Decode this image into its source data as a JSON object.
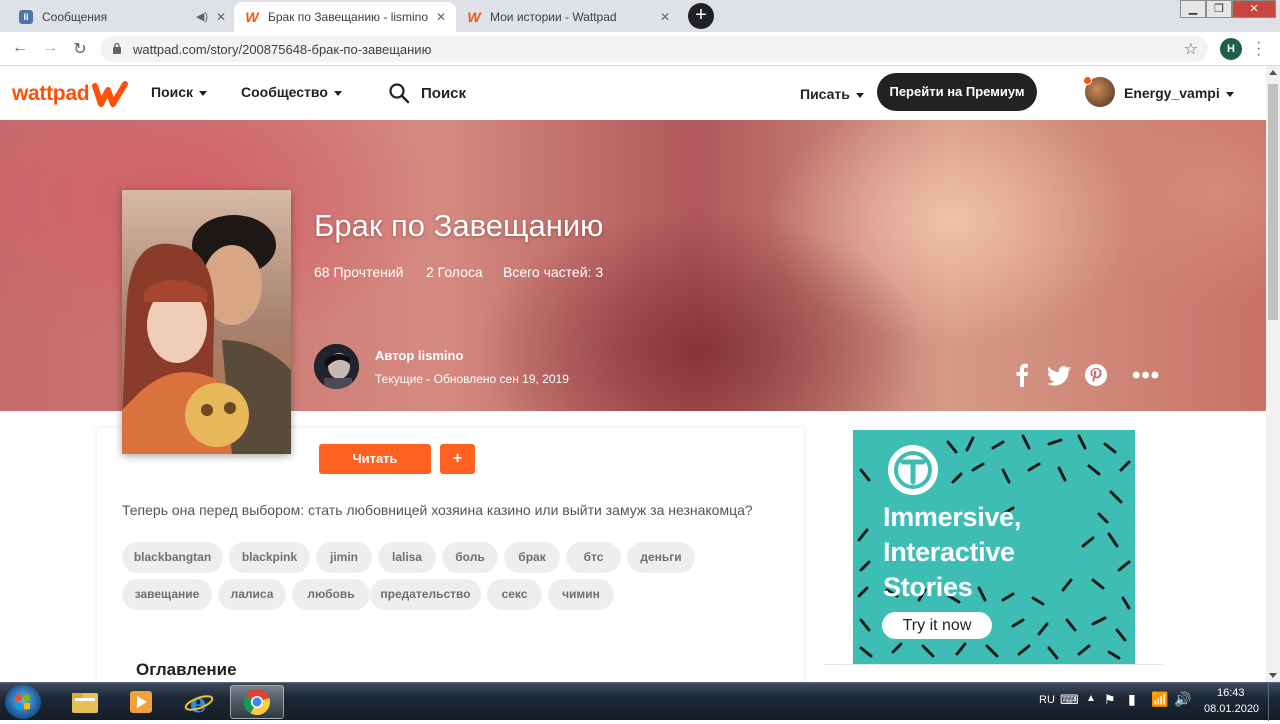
{
  "browser": {
    "tabs": [
      {
        "title": "Сообщения",
        "favicon": "vk-messages-icon",
        "active": false
      },
      {
        "title": "Брак по Завещанию - lismino -",
        "favicon": "wattpad-icon",
        "active": true
      },
      {
        "title": "Мои истории - Wattpad",
        "favicon": "wattpad-icon",
        "active": false
      }
    ],
    "new_tab": "+",
    "url": "wattpad.com/story/200875648-брак-по-завещанию",
    "profile_initial": "H"
  },
  "header": {
    "logo_text": "wattpad",
    "nav": {
      "search_label": "Поиск",
      "community_label": "Сообщество",
      "write_label": "Писать"
    },
    "search_placeholder": "Поиск",
    "premium_button": "Перейти на Премиум",
    "username": "Energy_vampi"
  },
  "story": {
    "title": "Брак по Завещанию",
    "stats": {
      "reads": "68 Прочтений",
      "votes": "2 Голоса",
      "parts": "Всего частей: 3"
    },
    "author_line": "Автор lismino",
    "status_line": "Текущие - Обновлено сен 19, 2019",
    "read_button": "Читать",
    "add_button": "+",
    "description": "Теперь она перед выбором: стать любовницей хозяина казино или выйти замуж за незнакомца?",
    "tags": [
      "blackbangtan",
      "blackpink",
      "jimin",
      "lalisa",
      "боль",
      "брак",
      "бтс",
      "деньги",
      "завещание",
      "лалиса",
      "любовь",
      "предательство",
      "секс",
      "чимин"
    ],
    "toc_heading": "Оглавление"
  },
  "ad": {
    "headline": [
      "Immersive,",
      "Interactive",
      "Stories"
    ],
    "cta": "Try it now",
    "bg_color": "#3dbdb3"
  },
  "taskbar": {
    "language": "RU",
    "time": "16:43",
    "date": "08.01.2020"
  },
  "colors": {
    "brand": "#ff500a",
    "button": "#ff6122"
  }
}
